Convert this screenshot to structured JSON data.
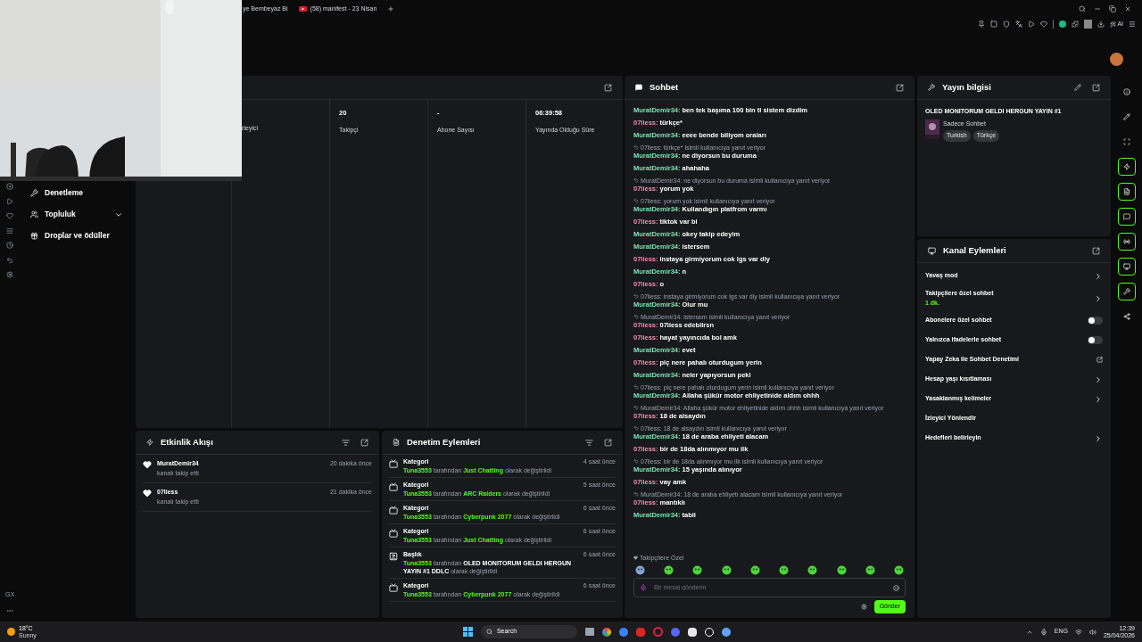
{
  "browser": {
    "tabs": [
      {
        "title": "ye Bembeyaz Bi"
      },
      {
        "title": "(58) manifest - 23 Nisan"
      }
    ],
    "ai_label": "AI"
  },
  "sidebar": {
    "items": [
      {
        "label": "Denetleme",
        "kind": "wrench"
      },
      {
        "label": "Topluluk",
        "kind": "users",
        "expanded": false
      },
      {
        "label": "Droplar ve ödüller",
        "kind": "gift"
      }
    ],
    "footer": "GX"
  },
  "stats": [
    {
      "label": "zleyici"
    },
    {
      "value": "20",
      "label": "Takipçi"
    },
    {
      "value": "-",
      "label": "Abone Sayısı"
    },
    {
      "value": "06:39:58",
      "label": "Yayında Olduğu Süre"
    }
  ],
  "activity": {
    "title": "Etkinlik Akışı",
    "items": [
      {
        "user": "MuratDemir34",
        "action": "kanalı takip etti",
        "time": "20 dakika önce"
      },
      {
        "user": "07liess",
        "action": "kanalı takip etti",
        "time": "21 dakika önce"
      }
    ]
  },
  "mod_actions": {
    "title": "Denetim Eylemleri",
    "items": [
      {
        "kind": "category",
        "title": "Kategori",
        "text": "**Tuna3553** tarafından **Just Chatting** olarak değiştirildi",
        "time": "4 saat önce"
      },
      {
        "kind": "category",
        "title": "Kategori",
        "text": "**Tuna3553** tarafından **ARC Raiders** olarak değiştirildi",
        "time": "5 saat önce"
      },
      {
        "kind": "category",
        "title": "Kategori",
        "text": "**Tuna3553** tarafından **Cyberpunk 2077** olarak değiştirildi",
        "time": "6 saat önce"
      },
      {
        "kind": "category",
        "title": "Kategori",
        "text": "**Tuna3553** tarafından **Just Chatting** olarak değiştirildi",
        "time": "6 saat önce"
      },
      {
        "kind": "title",
        "title": "Başlık",
        "text": "**Tuna3553** tarafından **OLED MONITORUM GELDI HERGUN YAYIN #1 DDLC** olarak değiştirildi",
        "time": "6 saat önce"
      },
      {
        "kind": "category",
        "title": "Kategori",
        "text": "**Tuna3553** tarafından **Cyberpunk 2077** olarak değiştirildi",
        "time": "6 saat önce"
      }
    ]
  },
  "chat": {
    "title": "Sohbet",
    "messages": [
      {
        "user": "MuratDemir34:",
        "color": "#7fe3b4",
        "text": "ben tek başıma 100 bin tl sistem dizdim"
      },
      {
        "user": "07liess:",
        "color": "#f08fae",
        "text": "türkçe*"
      },
      {
        "user": "MuratDemir34:",
        "color": "#7fe3b4",
        "text": "eeee bende biliyom oraları"
      },
      {
        "reply": "07liess: türkçe* isimli kullanıcıya yanıt veriyor",
        "user": "MuratDemir34:",
        "color": "#7fe3b4",
        "text": "ne diyorsun bu duruma"
      },
      {
        "user": "MuratDemir34:",
        "color": "#7fe3b4",
        "text": "ahahaha"
      },
      {
        "reply": "MuratDemir34: ne diyorsun bu duruma isimli kullanıcıya yanıt veriyor",
        "user": "07liess:",
        "color": "#f08fae",
        "text": "yorum yok"
      },
      {
        "reply": "07liess: yorum yok isimli kullanıcıya yanıt veriyor",
        "user": "MuratDemir34:",
        "color": "#7fe3b4",
        "text": "Kullandıgın platfrom varmı"
      },
      {
        "user": "07liess:",
        "color": "#f08fae",
        "text": "tiktok var bi"
      },
      {
        "user": "MuratDemir34:",
        "color": "#7fe3b4",
        "text": "okey takip edeyim"
      },
      {
        "user": "MuratDemir34:",
        "color": "#7fe3b4",
        "text": "istersem"
      },
      {
        "user": "07liess:",
        "color": "#f08fae",
        "text": "instaya girmiyorum cok lgs var diy"
      },
      {
        "user": "MuratDemir34:",
        "color": "#7fe3b4",
        "text": "n"
      },
      {
        "user": "07liess:",
        "color": "#f08fae",
        "text": "o"
      },
      {
        "reply": "07liess: instaya girmiyorum cok lgs var diy isimli kullanıcıya yanıt veriyor",
        "user": "MuratDemir34:",
        "color": "#7fe3b4",
        "text": "Olur mu"
      },
      {
        "reply": "MuratDemir34: istersem isimli kullanıcıya yanıt veriyor",
        "user": "07liess:",
        "color": "#f08fae",
        "text": "07liess edebilrsn"
      },
      {
        "user": "07liess:",
        "color": "#f08fae",
        "text": "hayat yayıncıda bol amk"
      },
      {
        "user": "MuratDemir34:",
        "color": "#7fe3b4",
        "text": "evet"
      },
      {
        "user": "07liess:",
        "color": "#f08fae",
        "text": "piç nere pahalı oturdugum yerin"
      },
      {
        "user": "MuratDemir34:",
        "color": "#7fe3b4",
        "text": "neler yapıyorsun peki"
      },
      {
        "reply": "07liess: piç nere pahalı oturdugum yerin isimli kullanıcıya yanıt veriyor",
        "user": "MuratDemir34:",
        "color": "#7fe3b4",
        "text": "Allaha şükür motor ehliyetinide aldım ohhh"
      },
      {
        "reply": "MuratDemir34: Allaha şükür motor ehliyetinide aldım ohhh isimli kullanıcıya yanıt veriyor",
        "user": "07liess:",
        "color": "#f08fae",
        "text": "18 de alsaydın"
      },
      {
        "reply": "07liess: 18 de alsaydın isimli kullanıcıya yanıt veriyor",
        "user": "MuratDemir34:",
        "color": "#7fe3b4",
        "text": "18 de araba ehliyeti alacam"
      },
      {
        "user": "07liess:",
        "color": "#f08fae",
        "text": "bir de 18da alınmıyor mu ilk"
      },
      {
        "reply": "07liess: bir de 18da alınmıyor mu ilk isimli kullanıcıya yanıt veriyor",
        "user": "MuratDemir34:",
        "color": "#7fe3b4",
        "text": "15 yaşında alınıyor"
      },
      {
        "user": "07liess:",
        "color": "#f08fae",
        "text": "vay amk"
      },
      {
        "reply": "MuratDemir34: 18 de araba ehliyeti alacam isimli kullanıcıya yanıt veriyor",
        "user": "07liess:",
        "color": "#f08fae",
        "text": "mantıklı"
      },
      {
        "user": "MuratDemir34:",
        "color": "#7fe3b4",
        "text": "tabii"
      }
    ],
    "emote_label": "Takipçilere Özel",
    "placeholder": "Bir mesaj gönderin",
    "send": "Gönder"
  },
  "stream_info": {
    "title": "Yayın bilgisi",
    "stream_title": "OLED MONITORUM GELDI HERGUN YAYIN #1",
    "category": "Sadece Sohbet",
    "tags": [
      "Turkish",
      "Türkçe"
    ]
  },
  "channel_actions": {
    "title": "Kanal Eylemleri",
    "items": [
      {
        "kind": "chevron",
        "label": "Yavaş mod"
      },
      {
        "kind": "chevron",
        "label": "Takipçilere özel sohbet",
        "sub": "1 dk."
      },
      {
        "kind": "toggle",
        "label": "Abonelere özel sohbet",
        "on": false
      },
      {
        "kind": "toggle",
        "label": "Yalnızca ifadelerle sohbet",
        "on": false
      },
      {
        "kind": "external",
        "label": "Yapay Zeka ile Sohbet Denetimi"
      },
      {
        "kind": "chevron",
        "label": "Hesap yaşı kısıtlaması"
      },
      {
        "kind": "chevron",
        "label": "Yasaklanmış kelimeler"
      },
      {
        "kind": "plain",
        "label": "İzleyici Yönlendir"
      },
      {
        "kind": "chevron",
        "label": "Hedefleri belirleyin"
      }
    ]
  },
  "rail": [
    {
      "kind": "info",
      "on": false
    },
    {
      "kind": "pencil",
      "on": false
    },
    {
      "kind": "scan",
      "on": false
    },
    {
      "kind": "bolt",
      "on": true
    },
    {
      "kind": "file",
      "on": true
    },
    {
      "kind": "chat",
      "on": true
    },
    {
      "kind": "radio",
      "on": true
    },
    {
      "kind": "monitor",
      "on": true
    },
    {
      "kind": "wrench",
      "on": true
    },
    {
      "kind": "share",
      "on": false
    }
  ],
  "taskbar": {
    "temp": "18°C",
    "weather": "Sunny",
    "search": "Search",
    "lang": "ENG",
    "time": "12:39",
    "date": "25/04/2026"
  }
}
